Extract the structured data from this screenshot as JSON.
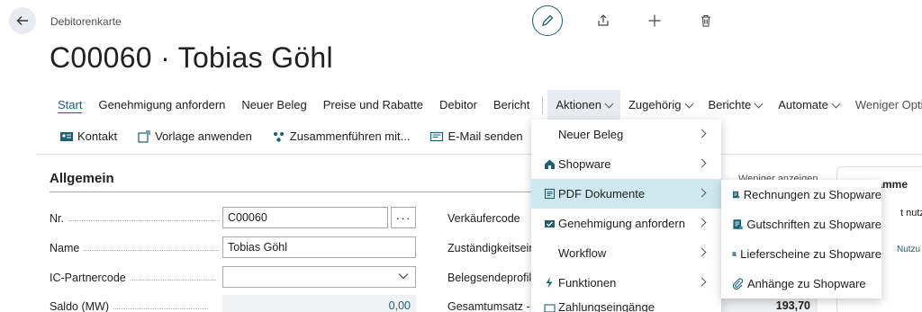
{
  "header": {
    "breadcrumb": "Debitorenkarte",
    "title": "C00060 · Tobias Göhl"
  },
  "actionbar": {
    "items": [
      {
        "label": "Start"
      },
      {
        "label": "Genehmigung anfordern"
      },
      {
        "label": "Neuer Beleg"
      },
      {
        "label": "Preise und Rabatte"
      },
      {
        "label": "Debitor"
      },
      {
        "label": "Bericht"
      },
      {
        "label": "Aktionen"
      },
      {
        "label": "Zugehörig"
      },
      {
        "label": "Berichte"
      },
      {
        "label": "Automate"
      },
      {
        "label": "Weniger Optionen"
      }
    ]
  },
  "promoted": {
    "contact": "Kontakt",
    "apply_template": "Vorlage anwenden",
    "merge": "Zusammenführen mit...",
    "send_email": "E-Mail senden"
  },
  "general": {
    "title": "Allgemein",
    "show_less": "Weniger anzeigen",
    "fields": {
      "no_label": "Nr.",
      "no_value": "C00060",
      "name_label": "Name",
      "name_value": "Tobias Göhl",
      "ic_label": "IC-Partnercode",
      "ic_value": "",
      "balance_label": "Saldo (MW)",
      "balance_value": "0,00"
    },
    "right_labels": {
      "salesperson": "Verkäufercode",
      "responsibility": "Zuständigkeitsein",
      "doc_profile": "Belegsendeprofil",
      "total_sales": "Gesamtumsatz - G"
    },
    "total_value": "193,70"
  },
  "factbox": {
    "title": "Zusamme",
    "line1": "t nutzt K",
    "line2": "Nutzu"
  },
  "aktionen_menu": {
    "items": [
      {
        "label": "Neuer Beleg",
        "icon": "none"
      },
      {
        "label": "Shopware",
        "icon": "home-icon"
      },
      {
        "label": "PDF Dokumente",
        "icon": "document-icon"
      },
      {
        "label": "Genehmigung anfordern",
        "icon": "approval-icon"
      },
      {
        "label": "Workflow",
        "icon": "none"
      },
      {
        "label": "Funktionen",
        "icon": "lightning-icon"
      },
      {
        "label": "Zahlungseingänge"
      }
    ]
  },
  "pdf_submenu": {
    "items": [
      {
        "label": "Rechnungen zu Shopware",
        "icon": "invoice-icon"
      },
      {
        "label": "Gutschriften zu Shopware",
        "icon": "credit-memo-icon"
      },
      {
        "label": "Lieferscheine zu Shopware",
        "icon": "shipment-icon"
      },
      {
        "label": "Anhänge zu Shopware",
        "icon": "paperclip-icon"
      }
    ]
  },
  "colors": {
    "accent": "#1d5f73",
    "menu_highlight": "#cde8ef",
    "readonly_bg": "#eef0f2"
  }
}
